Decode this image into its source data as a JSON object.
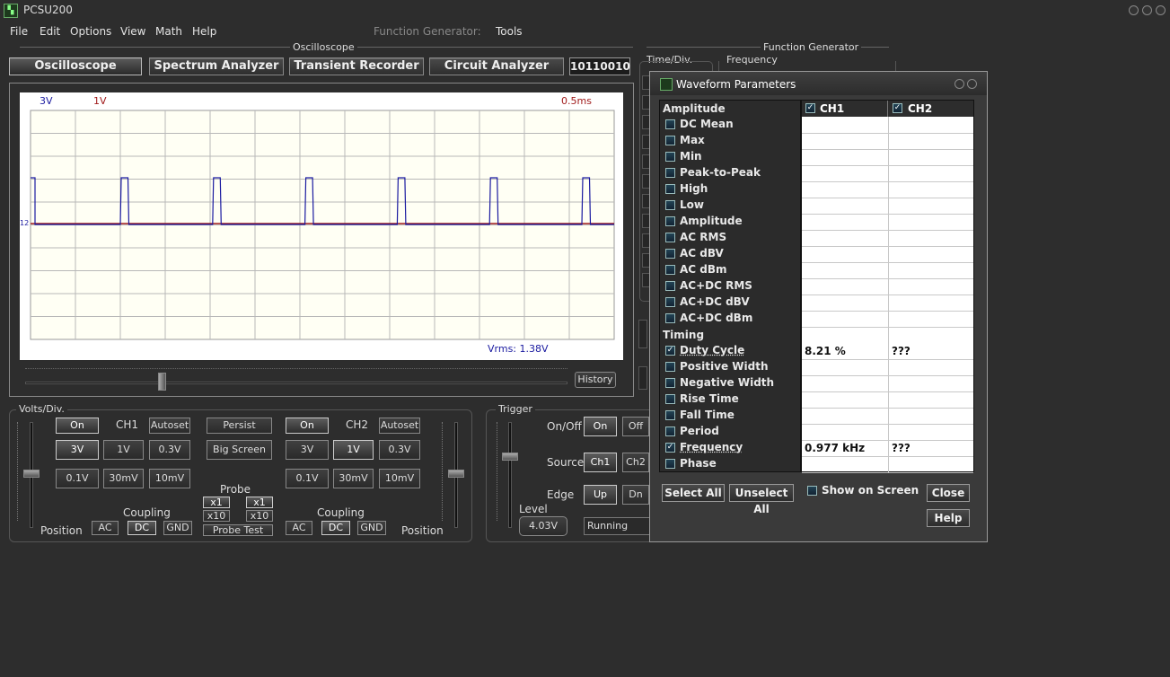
{
  "app": {
    "title": "PCSU200"
  },
  "menu": [
    "File",
    "Edit",
    "Options",
    "View",
    "Math",
    "Help"
  ],
  "menu_right": {
    "function_generator": "Function Generator:",
    "tools": "Tools"
  },
  "groups": {
    "oscilloscope": "Oscilloscope",
    "function_generator": "Function Generator",
    "time_div": "Time/Div.",
    "frequency": "Frequency"
  },
  "modes": {
    "oscilloscope": "Oscilloscope",
    "spectrum": "Spectrum Analyzer",
    "transient": "Transient Recorder",
    "circuit": "Circuit Analyzer",
    "bits": "10110010"
  },
  "screen": {
    "ch1_scale": "3V",
    "ch2_scale": "1V",
    "timebase": "0.5ms",
    "vrms": "Vrms: 1.38V",
    "marker": "12"
  },
  "history_label": "History",
  "volts": {
    "caption": "Volts/Div.",
    "ch1": {
      "on": "On",
      "label": "CH1",
      "autoset": "Autoset",
      "r1": [
        "3V",
        "1V",
        "0.3V"
      ],
      "r2": [
        "0.1V",
        "30mV",
        "10mV"
      ],
      "coupling": "Coupling",
      "ac": "AC",
      "dc": "DC",
      "gnd": "GND",
      "position": "Position"
    },
    "ch2": {
      "on": "On",
      "label": "CH2",
      "autoset": "Autoset",
      "r1": [
        "3V",
        "1V",
        "0.3V"
      ],
      "r2": [
        "0.1V",
        "30mV",
        "10mV"
      ],
      "coupling": "Coupling",
      "ac": "AC",
      "dc": "DC",
      "gnd": "GND",
      "position": "Position"
    },
    "persist": "Persist",
    "big_screen": "Big Screen",
    "probe": "Probe",
    "x1": "x1",
    "x10": "x10",
    "probe_test": "Probe Test"
  },
  "trigger": {
    "caption": "Trigger",
    "onoff": "On/Off",
    "on": "On",
    "off": "Off",
    "source": "Source",
    "ch1": "Ch1",
    "ch2": "Ch2",
    "edge": "Edge",
    "up": "Up",
    "dn": "Dn",
    "level": "Level",
    "level_value": "4.03V",
    "status": "Running"
  },
  "dialog": {
    "title": "Waveform Parameters",
    "ch1": "CH1",
    "ch2": "CH2",
    "amplitude_section": "Amplitude",
    "timing_section": "Timing",
    "amplitude": [
      {
        "label": "DC  Mean",
        "checked": false,
        "ch1": "",
        "ch2": ""
      },
      {
        "label": "Max",
        "checked": false,
        "ch1": "",
        "ch2": ""
      },
      {
        "label": "Min",
        "checked": false,
        "ch1": "",
        "ch2": ""
      },
      {
        "label": "Peak-to-Peak",
        "checked": false,
        "ch1": "",
        "ch2": ""
      },
      {
        "label": "High",
        "checked": false,
        "ch1": "",
        "ch2": ""
      },
      {
        "label": "Low",
        "checked": false,
        "ch1": "",
        "ch2": ""
      },
      {
        "label": "Amplitude",
        "checked": false,
        "ch1": "",
        "ch2": ""
      },
      {
        "label": "AC RMS",
        "checked": false,
        "ch1": "",
        "ch2": ""
      },
      {
        "label": "AC dBV",
        "checked": false,
        "ch1": "",
        "ch2": ""
      },
      {
        "label": "AC dBm",
        "checked": false,
        "ch1": "",
        "ch2": ""
      },
      {
        "label": "AC+DC RMS",
        "checked": false,
        "ch1": "",
        "ch2": ""
      },
      {
        "label": "AC+DC dBV",
        "checked": false,
        "ch1": "",
        "ch2": ""
      },
      {
        "label": "AC+DC dBm",
        "checked": false,
        "ch1": "",
        "ch2": ""
      }
    ],
    "timing": [
      {
        "label": "Duty Cycle",
        "checked": true,
        "ch1": "8.21 %",
        "ch2": "???"
      },
      {
        "label": "Positive Width",
        "checked": false,
        "ch1": "",
        "ch2": ""
      },
      {
        "label": "Negative Width",
        "checked": false,
        "ch1": "",
        "ch2": ""
      },
      {
        "label": "Rise Time",
        "checked": false,
        "ch1": "",
        "ch2": ""
      },
      {
        "label": "Fall Time",
        "checked": false,
        "ch1": "",
        "ch2": ""
      },
      {
        "label": "Period",
        "checked": false,
        "ch1": "",
        "ch2": ""
      },
      {
        "label": "Frequency",
        "checked": true,
        "ch1": "0.977 kHz",
        "ch2": "???"
      },
      {
        "label": "Phase",
        "checked": false,
        "ch1": "",
        "ch2": ""
      }
    ],
    "select_all": "Select All",
    "unselect_all": "Unselect All",
    "show_on_screen": "Show on Screen",
    "close": "Close",
    "help": "Help"
  },
  "colors": {
    "ch1_trace": "#1a1aa0",
    "ch2_trace": "#a01a1a",
    "grid": "#b8b8b8"
  }
}
